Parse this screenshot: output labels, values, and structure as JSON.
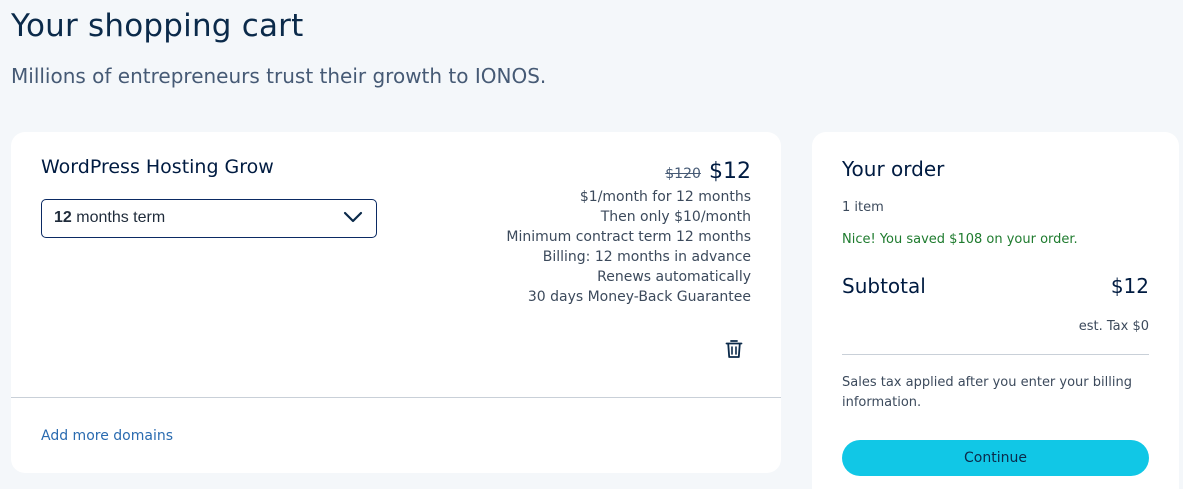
{
  "header": {
    "title": "Your shopping cart",
    "subtitle": "Millions of entrepreneurs trust their growth to IONOS."
  },
  "cart": {
    "product_name": "WordPress Hosting Grow",
    "term_select": {
      "value_bold": "12",
      "value_rest": " months term"
    },
    "old_price": "$120",
    "new_price": "$12",
    "price_details": [
      "$1/month for 12 months",
      "Then only $10/month",
      "Minimum contract term 12 months",
      "Billing: 12 months in advance",
      "Renews automatically",
      "30 days Money-Back Guarantee"
    ],
    "delete_icon": "trash-icon",
    "add_domains_label": "Add more domains"
  },
  "order": {
    "title": "Your order",
    "item_count": "1 item",
    "savings_message": "Nice! You saved $108 on your order.",
    "subtotal_label": "Subtotal",
    "subtotal_value": "$12",
    "tax_note": "est. Tax $0",
    "sales_tax_note": "Sales tax applied after you enter your billing information.",
    "continue_label": "Continue"
  },
  "colors": {
    "background": "#f4f7fa",
    "accent_button": "#11c7e6",
    "savings_text": "#1e7b2e",
    "link": "#2a6bb0"
  }
}
